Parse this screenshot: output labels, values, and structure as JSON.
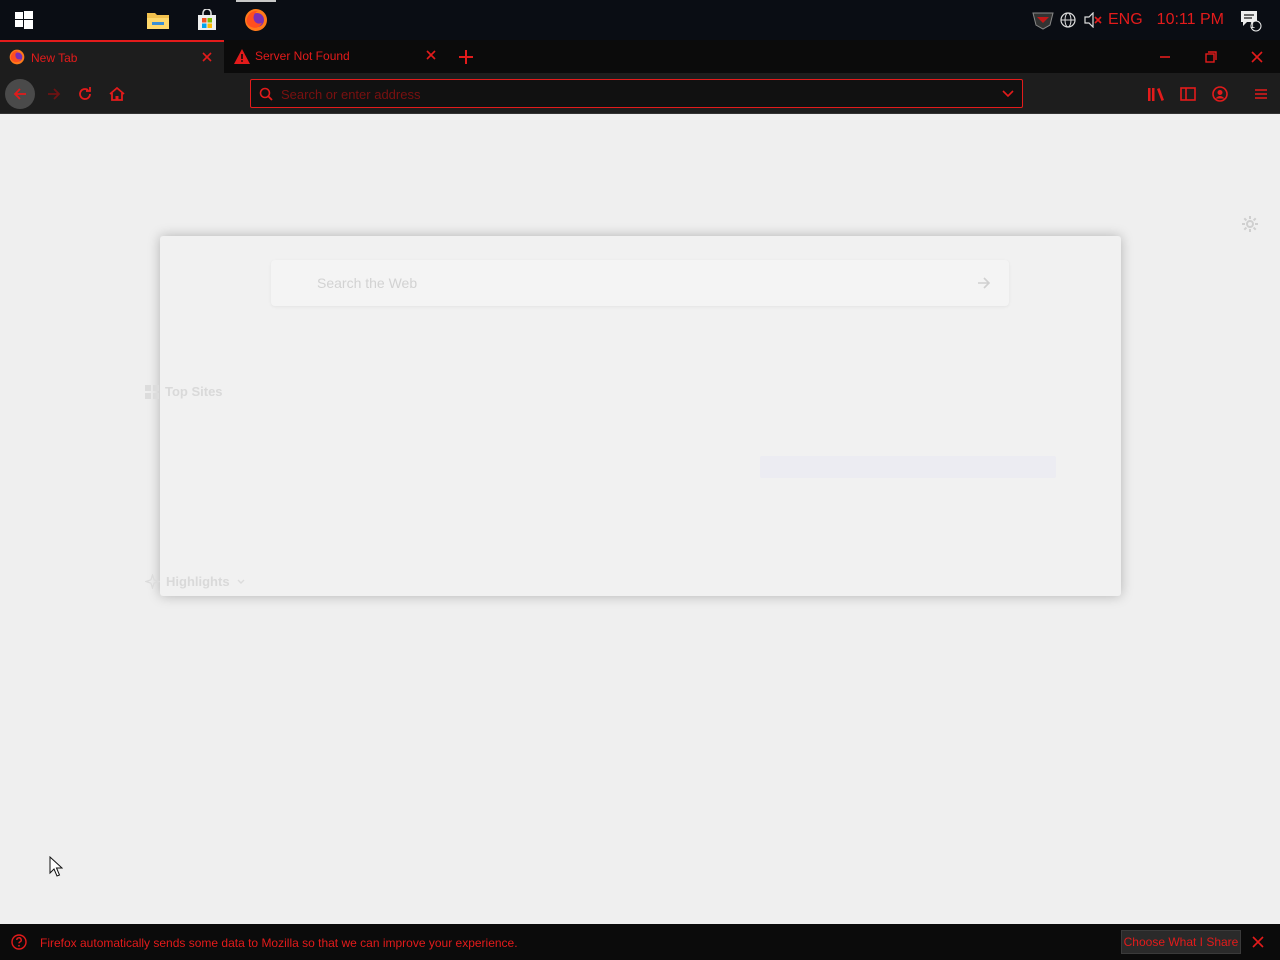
{
  "taskbar": {
    "pinned": [
      {
        "name": "start",
        "icon": "windows-start-icon"
      },
      {
        "name": "file-explorer",
        "icon": "folder-icon"
      },
      {
        "name": "store",
        "icon": "store-bag-icon"
      },
      {
        "name": "firefox",
        "icon": "firefox-icon",
        "active": true
      }
    ],
    "tray": {
      "language": "ENG",
      "time": "10:11 PM",
      "notification_count": "1"
    }
  },
  "browser": {
    "tabs": [
      {
        "label": "New Tab",
        "icon": "firefox-icon",
        "selected": true
      },
      {
        "label": "Server Not Found",
        "icon": "warning-icon",
        "selected": false
      }
    ],
    "urlbar": {
      "placeholder": "Search or enter address"
    }
  },
  "newtab": {
    "search_placeholder": "Search the Web",
    "top_sites_label": "Top Sites",
    "highlights_label": "Highlights"
  },
  "notification": {
    "message": "Firefox automatically sends some data to Mozilla so that we can improve your experience.",
    "button_label": "Choose What I Share"
  },
  "colors": {
    "accent": "#e31b1b",
    "chrome_dark": "#0b0b0b",
    "toolbar": "#1d1d1d",
    "content_bg": "#efefef"
  }
}
